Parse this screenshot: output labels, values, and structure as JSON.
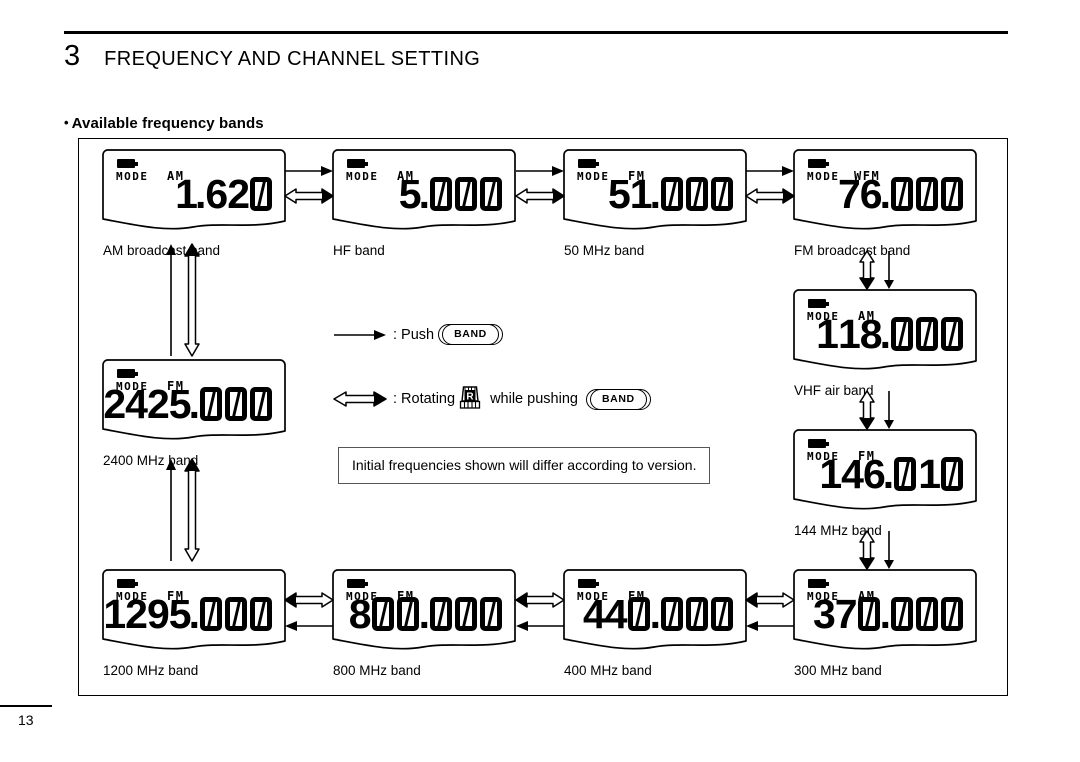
{
  "document": {
    "chapter_number": "3",
    "chapter_title": "FREQUENCY AND CHANNEL SETTING",
    "section_bullet": "•",
    "section_title": "Available frequency bands",
    "page_number": "13"
  },
  "legend": {
    "push_label": ": Push",
    "push_button": "BAND",
    "rotate_label": ": Rotating",
    "rotate_suffix": "while pushing",
    "rotate_button": "BAND",
    "dial_label": "R",
    "note": "Initial frequencies shown will differ according to version."
  },
  "displays": [
    {
      "id": "am-broadcast",
      "mode_label": "MODE",
      "mode": "AM",
      "frequency": "1.620",
      "caption": "AM broadcast band"
    },
    {
      "id": "hf",
      "mode_label": "MODE",
      "mode": "AM",
      "frequency": "5.000",
      "caption": "HF band"
    },
    {
      "id": "50mhz",
      "mode_label": "MODE",
      "mode": "FM",
      "frequency": "51.000",
      "caption": "50 MHz band"
    },
    {
      "id": "fm-broadcast",
      "mode_label": "MODE",
      "mode": "WFM",
      "frequency": "76.000",
      "caption": "FM broadcast band"
    },
    {
      "id": "vhf-air",
      "mode_label": "MODE",
      "mode": "AM",
      "frequency": "118.000",
      "caption": "VHF air band"
    },
    {
      "id": "144mhz",
      "mode_label": "MODE",
      "mode": "FM",
      "frequency": "146.010",
      "caption": "144 MHz band"
    },
    {
      "id": "300mhz",
      "mode_label": "MODE",
      "mode": "AM",
      "frequency": "370.000",
      "caption": "300 MHz band"
    },
    {
      "id": "400mhz",
      "mode_label": "MODE",
      "mode": "FM",
      "frequency": "440.000",
      "caption": "400 MHz band"
    },
    {
      "id": "800mhz",
      "mode_label": "MODE",
      "mode": "FM",
      "frequency": "800.000",
      "caption": "800 MHz band"
    },
    {
      "id": "1200mhz",
      "mode_label": "MODE",
      "mode": "FM",
      "frequency": "1295.000",
      "caption": "1200 MHz band"
    },
    {
      "id": "2400mhz",
      "mode_label": "MODE",
      "mode": "FM",
      "frequency": "2425.000",
      "caption": "2400 MHz band"
    }
  ],
  "colors": {
    "ink": "#000000",
    "note_border": "#555555",
    "paper": "#ffffff"
  }
}
